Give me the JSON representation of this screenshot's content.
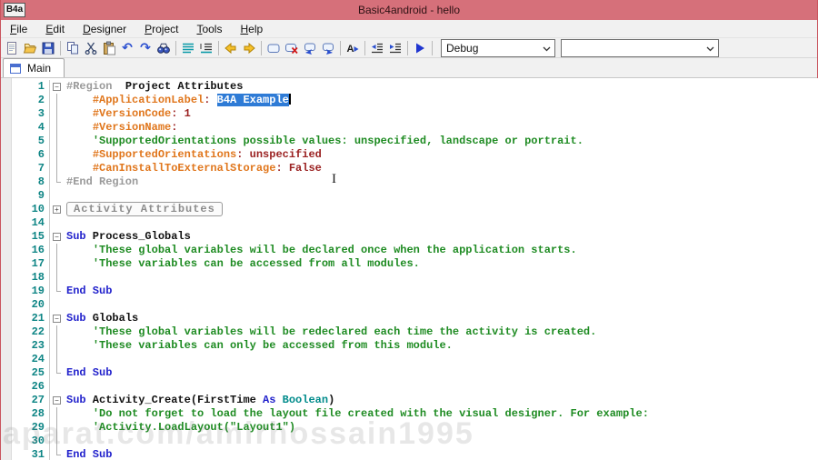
{
  "window": {
    "title": "Basic4android - hello",
    "logo_text": "B4a"
  },
  "menu": {
    "items": [
      {
        "label": "File"
      },
      {
        "label": "Edit"
      },
      {
        "label": "Designer"
      },
      {
        "label": "Project"
      },
      {
        "label": "Tools"
      },
      {
        "label": "Help"
      }
    ]
  },
  "toolbar": {
    "icons": [
      "new-file",
      "open-folder",
      "save",
      "sep",
      "copy",
      "cut",
      "paste",
      "undo",
      "redo",
      "find",
      "sep",
      "format-lines",
      "format-lines-2",
      "sep",
      "nav-back",
      "nav-forward",
      "sep",
      "select-block",
      "delete-block",
      "comment",
      "uncomment",
      "sep",
      "autocomplete",
      "sep",
      "outdent",
      "indent",
      "sep",
      "run",
      "sep"
    ],
    "build_config_value": "Debug",
    "module_value": ""
  },
  "tabs": [
    {
      "label": "Main",
      "active": true
    }
  ],
  "colors": {
    "titlebar": "#d6707a",
    "selection": "#2e7bd6",
    "attribute": "#e0761c",
    "attr_value": "#9b2222",
    "comment": "#1e8b22",
    "keyword": "#2222cc",
    "type": "#008b8b",
    "region": "#9a9a9a",
    "line_number": "#0e8585"
  },
  "editor": {
    "lines": [
      {
        "n": "1",
        "fold": "minus",
        "seg": [
          [
            "region",
            "#Region  "
          ],
          [
            "bold",
            "Project Attributes"
          ]
        ]
      },
      {
        "n": "2",
        "fold": "guide",
        "seg": [
          [
            "plain",
            "    "
          ],
          [
            "attr",
            "#ApplicationLabel"
          ],
          [
            "val",
            ": "
          ],
          [
            "sel",
            "B4A Example"
          ],
          [
            "caret",
            ""
          ]
        ]
      },
      {
        "n": "3",
        "fold": "guide",
        "seg": [
          [
            "plain",
            "    "
          ],
          [
            "attr",
            "#VersionCode"
          ],
          [
            "val",
            ": 1"
          ]
        ]
      },
      {
        "n": "4",
        "fold": "guide",
        "seg": [
          [
            "plain",
            "    "
          ],
          [
            "attr",
            "#VersionName"
          ],
          [
            "val",
            ":"
          ]
        ]
      },
      {
        "n": "5",
        "fold": "guide",
        "seg": [
          [
            "plain",
            "    "
          ],
          [
            "cmt",
            "'SupportedOrientations possible values: unspecified, landscape or portrait."
          ]
        ]
      },
      {
        "n": "6",
        "fold": "guide",
        "seg": [
          [
            "plain",
            "    "
          ],
          [
            "attr",
            "#SupportedOrientations"
          ],
          [
            "val",
            ": unspecified"
          ]
        ]
      },
      {
        "n": "7",
        "fold": "guide",
        "seg": [
          [
            "plain",
            "    "
          ],
          [
            "attr",
            "#CanInstallToExternalStorage"
          ],
          [
            "val",
            ": False"
          ]
        ]
      },
      {
        "n": "8",
        "fold": "end",
        "seg": [
          [
            "region",
            "#End Region"
          ]
        ]
      },
      {
        "n": "9",
        "fold": "",
        "seg": []
      },
      {
        "n": "10",
        "fold": "plus",
        "seg": [
          [
            "box",
            "Activity Attributes"
          ]
        ]
      },
      {
        "n": "14",
        "fold": "",
        "seg": []
      },
      {
        "n": "15",
        "fold": "minus",
        "seg": [
          [
            "kw",
            "Sub"
          ],
          [
            "plain",
            " Process_Globals"
          ]
        ]
      },
      {
        "n": "16",
        "fold": "guide",
        "seg": [
          [
            "plain",
            "    "
          ],
          [
            "cmt",
            "'These global variables will be declared once when the application starts."
          ]
        ]
      },
      {
        "n": "17",
        "fold": "guide",
        "seg": [
          [
            "plain",
            "    "
          ],
          [
            "cmt",
            "'These variables can be accessed from all modules."
          ]
        ]
      },
      {
        "n": "18",
        "fold": "guide",
        "seg": []
      },
      {
        "n": "19",
        "fold": "end",
        "seg": [
          [
            "kw",
            "End Sub"
          ]
        ]
      },
      {
        "n": "20",
        "fold": "",
        "seg": []
      },
      {
        "n": "21",
        "fold": "minus",
        "seg": [
          [
            "kw",
            "Sub"
          ],
          [
            "plain",
            " Globals"
          ]
        ]
      },
      {
        "n": "22",
        "fold": "guide",
        "seg": [
          [
            "plain",
            "    "
          ],
          [
            "cmt",
            "'These global variables will be redeclared each time the activity is created."
          ]
        ]
      },
      {
        "n": "23",
        "fold": "guide",
        "seg": [
          [
            "plain",
            "    "
          ],
          [
            "cmt",
            "'These variables can only be accessed from this module."
          ]
        ]
      },
      {
        "n": "24",
        "fold": "guide",
        "seg": []
      },
      {
        "n": "25",
        "fold": "end",
        "seg": [
          [
            "kw",
            "End Sub"
          ]
        ]
      },
      {
        "n": "26",
        "fold": "",
        "seg": []
      },
      {
        "n": "27",
        "fold": "minus",
        "seg": [
          [
            "kw",
            "Sub"
          ],
          [
            "plain",
            " Activity_Create(FirstTime "
          ],
          [
            "kw",
            "As"
          ],
          [
            "typ",
            " Boolean"
          ],
          [
            "plain",
            ")"
          ]
        ]
      },
      {
        "n": "28",
        "fold": "guide",
        "seg": [
          [
            "plain",
            "    "
          ],
          [
            "cmt",
            "'Do not forget to load the layout file created with the visual designer. For example:"
          ]
        ]
      },
      {
        "n": "29",
        "fold": "guide",
        "seg": [
          [
            "plain",
            "    "
          ],
          [
            "cmt",
            "'Activity.LoadLayout(\"Layout1\")"
          ]
        ]
      },
      {
        "n": "30",
        "fold": "guide",
        "seg": []
      },
      {
        "n": "31",
        "fold": "end",
        "seg": [
          [
            "kw",
            "End Sub"
          ]
        ]
      }
    ]
  },
  "watermark": {
    "text": "aparat.com/amirhossain1995"
  }
}
